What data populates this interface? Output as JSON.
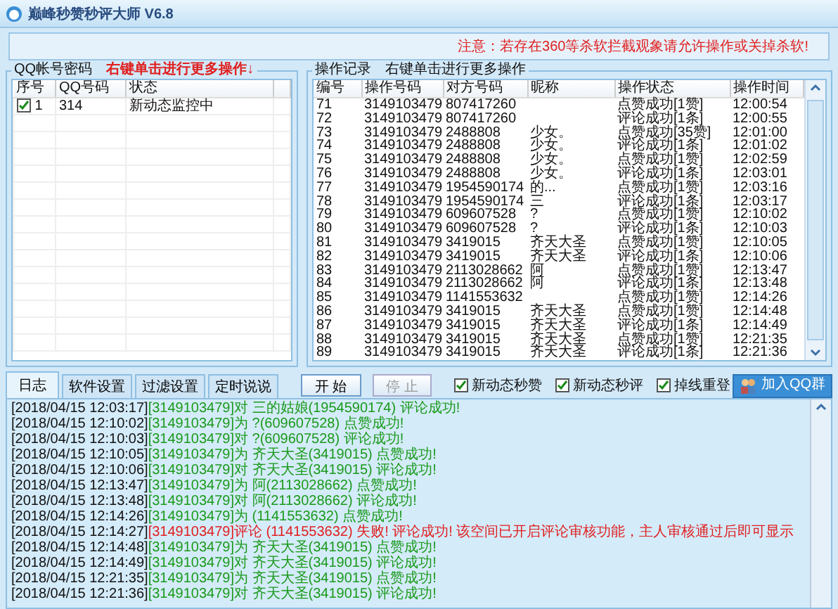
{
  "window": {
    "title": "巅峰秒赞秒评大师 V6.8"
  },
  "notice": "注意：若存在360等杀软拦截观象请允许操作或关掉杀软!",
  "accounts": {
    "title": "QQ帐号密码",
    "hint": "右键单击进行更多操作↓",
    "columns": [
      "序号",
      "QQ号码",
      "状态"
    ],
    "rows": [
      {
        "checked": true,
        "index": "1",
        "qq": "314",
        "status": "新动态监控中"
      }
    ]
  },
  "records": {
    "title": "操作记录",
    "hint": "右键单击进行更多操作",
    "columns": [
      "编号",
      "操作号码",
      "对方号码",
      "昵称",
      "操作状态",
      "操作时间"
    ],
    "rows": [
      [
        "71",
        "3149103479",
        "807417260",
        "",
        "点赞成功[1赞]",
        "12:00:54"
      ],
      [
        "72",
        "3149103479",
        "807417260",
        "",
        "评论成功[1条]",
        "12:00:55"
      ],
      [
        "73",
        "3149103479",
        "2488808",
        "少女。",
        "点赞成功[35赞]",
        "12:01:00"
      ],
      [
        "74",
        "3149103479",
        "2488808",
        "少女。",
        "评论成功[1条]",
        "12:01:02"
      ],
      [
        "75",
        "3149103479",
        "2488808",
        "少女。",
        "点赞成功[1赞]",
        "12:02:59"
      ],
      [
        "76",
        "3149103479",
        "2488808",
        "少女。",
        "评论成功[1条]",
        "12:03:01"
      ],
      [
        "77",
        "3149103479",
        "1954590174",
        "的...",
        "点赞成功[1赞]",
        "12:03:16"
      ],
      [
        "78",
        "3149103479",
        "1954590174",
        "三",
        "评论成功[1条]",
        "12:03:17"
      ],
      [
        "79",
        "3149103479",
        "609607528",
        "?",
        "点赞成功[1赞]",
        "12:10:02"
      ],
      [
        "80",
        "3149103479",
        "609607528",
        "?",
        "评论成功[1条]",
        "12:10:03"
      ],
      [
        "81",
        "3149103479",
        "3419015",
        "齐天大圣",
        "点赞成功[1赞]",
        "12:10:05"
      ],
      [
        "82",
        "3149103479",
        "3419015",
        "齐天大圣",
        "评论成功[1条]",
        "12:10:06"
      ],
      [
        "83",
        "3149103479",
        "2113028662",
        "阿",
        "点赞成功[1赞]",
        "12:13:47"
      ],
      [
        "84",
        "3149103479",
        "2113028662",
        "阿",
        "评论成功[1条]",
        "12:13:48"
      ],
      [
        "85",
        "3149103479",
        "1141553632",
        "",
        "点赞成功[1赞]",
        "12:14:26"
      ],
      [
        "86",
        "3149103479",
        "3419015",
        "齐天大圣",
        "点赞成功[1赞]",
        "12:14:48"
      ],
      [
        "87",
        "3149103479",
        "3419015",
        "齐天大圣",
        "评论成功[1条]",
        "12:14:49"
      ],
      [
        "88",
        "3149103479",
        "3419015",
        "齐天大圣",
        "点赞成功[1赞]",
        "12:21:35"
      ],
      [
        "89",
        "3149103479",
        "3419015",
        "齐天大圣",
        "评论成功[1条]",
        "12:21:36"
      ]
    ]
  },
  "tabs": [
    {
      "label": "日志",
      "selected": true
    },
    {
      "label": "软件设置",
      "selected": false
    },
    {
      "label": "过滤设置",
      "selected": false
    },
    {
      "label": "定时说说",
      "selected": false
    }
  ],
  "buttons": [
    {
      "label": "开 始",
      "disabled": false
    },
    {
      "label": "停 止",
      "disabled": true
    }
  ],
  "options": [
    {
      "label": "新动态秒赞",
      "checked": true
    },
    {
      "label": "新动态秒评",
      "checked": true
    },
    {
      "label": "掉线重登",
      "checked": true
    }
  ],
  "join_button": "加入QQ群",
  "log": [
    {
      "time": "[2018/04/15 12:03:17]",
      "message": "[3149103479]对 三的姑娘(1954590174) 评论成功!",
      "kind": "ok"
    },
    {
      "time": "[2018/04/15 12:10:02]",
      "message": "[3149103479]为 ?(609607528) 点赞成功!",
      "kind": "ok"
    },
    {
      "time": "[2018/04/15 12:10:03]",
      "message": "[3149103479]对 ?(609607528) 评论成功!",
      "kind": "ok"
    },
    {
      "time": "[2018/04/15 12:10:05]",
      "message": "[3149103479]为 齐天大圣(3419015) 点赞成功!",
      "kind": "ok"
    },
    {
      "time": "[2018/04/15 12:10:06]",
      "message": "[3149103479]对 齐天大圣(3419015) 评论成功!",
      "kind": "ok"
    },
    {
      "time": "[2018/04/15 12:13:47]",
      "message": "[3149103479]为 阿(2113028662) 点赞成功!",
      "kind": "ok"
    },
    {
      "time": "[2018/04/15 12:13:48]",
      "message": "[3149103479]对 阿(2113028662) 评论成功!",
      "kind": "ok"
    },
    {
      "time": "[2018/04/15 12:14:26]",
      "message": "[3149103479]为 (1141553632) 点赞成功!",
      "kind": "ok"
    },
    {
      "time": "[2018/04/15 12:14:27]",
      "message": "[3149103479]评论 (1141553632) 失败! 评论成功! 该空间已开启评论审核功能，主人审核通过后即可显示",
      "kind": "error"
    },
    {
      "time": "[2018/04/15 12:14:48]",
      "message": "[3149103479]为 齐天大圣(3419015) 点赞成功!",
      "kind": "ok"
    },
    {
      "time": "[2018/04/15 12:14:49]",
      "message": "[3149103479]对 齐天大圣(3419015) 评论成功!",
      "kind": "ok"
    },
    {
      "time": "[2018/04/15 12:21:35]",
      "message": "[3149103479]为 齐天大圣(3419015) 点赞成功!",
      "kind": "ok"
    },
    {
      "time": "[2018/04/15 12:21:36]",
      "message": "[3149103479]对 齐天大圣(3419015) 评论成功!",
      "kind": "ok"
    }
  ]
}
